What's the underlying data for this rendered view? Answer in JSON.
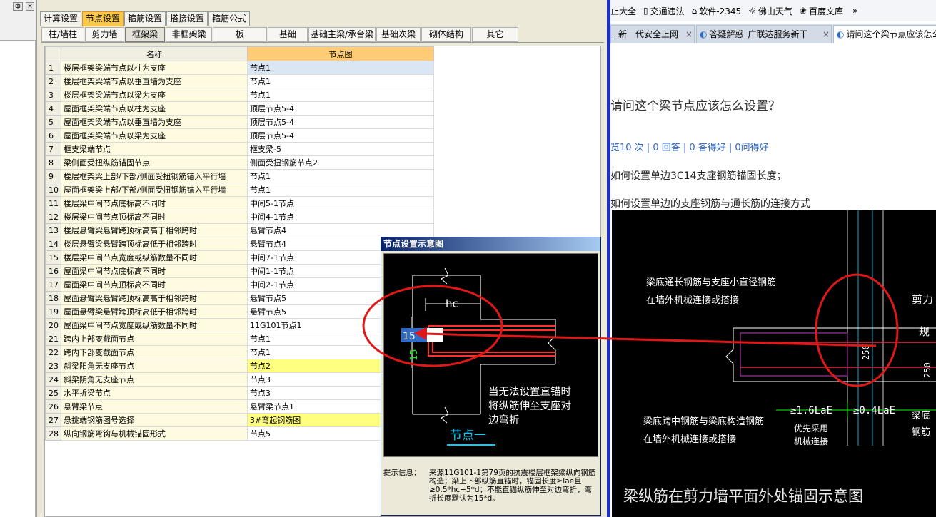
{
  "left_strip": {
    "pin": "ф",
    "close": "×"
  },
  "main_tabs": [
    "计算设置",
    "节点设置",
    "箍筋设置",
    "搭接设置",
    "箍筋公式"
  ],
  "main_tab_active": 1,
  "sub_tabs": [
    "柱/墙柱",
    "剪力墙",
    "框架梁",
    "非框架梁",
    "板",
    "基础",
    "基础主梁/承台梁",
    "基础次梁",
    "砌体结构",
    "其它"
  ],
  "sub_tab_active": 2,
  "grid": {
    "headers": [
      "",
      "名称",
      "节点图"
    ],
    "rows": [
      {
        "no": "1",
        "name": "楼层框架梁端节点以柱为支座",
        "value": "节点1"
      },
      {
        "no": "2",
        "name": "楼层框架梁端节点以垂直墙为支座",
        "value": "节点1"
      },
      {
        "no": "3",
        "name": "楼层框架梁端节点以梁为支座",
        "value": "节点1"
      },
      {
        "no": "4",
        "name": "屋面框架梁端节点以柱为支座",
        "value": "顶层节点5-4"
      },
      {
        "no": "5",
        "name": "屋面框架梁端节点以垂直墙为支座",
        "value": "顶层节点5-4"
      },
      {
        "no": "6",
        "name": "屋面框架梁端节点以梁为支座",
        "value": "顶层节点5-4"
      },
      {
        "no": "7",
        "name": "框支梁端节点",
        "value": "框支梁-5"
      },
      {
        "no": "8",
        "name": "梁侧面受扭纵筋锚固节点",
        "value": "侧面受扭钢筋节点2"
      },
      {
        "no": "9",
        "name": "楼层框架梁上部/下部/侧面受扭钢筋锚入平行墙",
        "value": "节点1"
      },
      {
        "no": "10",
        "name": "屋面框架梁上部/下部/侧面受扭钢筋锚入平行墙",
        "value": "节点1"
      },
      {
        "no": "11",
        "name": "楼层梁中间节点底标高不同时",
        "value": "中间5-1节点"
      },
      {
        "no": "12",
        "name": "楼层梁中间节点顶标高不同时",
        "value": "中间4-1节点"
      },
      {
        "no": "13",
        "name": "楼层悬臂梁悬臂跨顶标高高于相邻跨时",
        "value": "悬臂节点4"
      },
      {
        "no": "14",
        "name": "楼层悬臂梁悬臂跨顶标高低于相邻跨时",
        "value": "悬臂节点4"
      },
      {
        "no": "15",
        "name": "楼层梁中间节点宽度或纵筋数量不同时",
        "value": "中间7-1节点"
      },
      {
        "no": "16",
        "name": "屋面梁中间节点底标高不同时",
        "value": "中间1-1节点"
      },
      {
        "no": "17",
        "name": "屋面梁中间节点顶标高不同时",
        "value": "中间2-1节点"
      },
      {
        "no": "18",
        "name": "屋面悬臂梁悬臂跨顶标高高于相邻跨时",
        "value": "悬臂节点5"
      },
      {
        "no": "19",
        "name": "屋面悬臂梁悬臂跨顶标高低于相邻跨时",
        "value": "悬臂节点5"
      },
      {
        "no": "20",
        "name": "屋面梁中间节点宽度或纵筋数量不同时",
        "value": "11G101节点1"
      },
      {
        "no": "21",
        "name": "跨内上部变截面节点",
        "value": "节点1"
      },
      {
        "no": "22",
        "name": "跨内下部变截面节点",
        "value": "节点1"
      },
      {
        "no": "23",
        "name": "斜梁阳角无支座节点",
        "value": "节点2"
      },
      {
        "no": "24",
        "name": "斜梁阴角无支座节点",
        "value": "节点3"
      },
      {
        "no": "25",
        "name": "水平折梁节点",
        "value": "节点3"
      },
      {
        "no": "26",
        "name": "悬臂梁节点",
        "value": "悬臂梁节点1"
      },
      {
        "no": "27",
        "name": "悬挑端钢筋图号选择",
        "value": "3#弯起钢筋图"
      },
      {
        "no": "28",
        "name": "纵向钢筋弯钩与机械锚固形式",
        "value": "节点5"
      }
    ]
  },
  "popup": {
    "title": "节点设置示意图",
    "diagram": {
      "hc_label": "hc",
      "edit_value": "15",
      "vertical_label": "15",
      "note_lines": [
        "当无法设置直锚时",
        "将纵筋伸至支座对",
        "边弯折"
      ],
      "node_label": "节点一"
    },
    "hint_label": "提示信息：",
    "hint_text": "来源11G101-1第79页的抗震楼层框架梁纵向钢筋构造；梁上下部纵筋直锚时，锚固长度≥lae且≥0.5*hc+5*d；不能直锚纵筋伸至对边弯折，弯折长度默认为15*d。"
  },
  "browser": {
    "bookmarks": [
      {
        "icon": "",
        "label": "止大全"
      },
      {
        "icon": "page-icon",
        "label": "交通违法"
      },
      {
        "icon": "house-icon",
        "label": "软件-2345"
      },
      {
        "icon": "sun-icon",
        "label": "佛山天气"
      },
      {
        "icon": "paw-icon",
        "label": "百度文库"
      },
      {
        "icon": "more-icon",
        "label": "»"
      }
    ],
    "tabs": [
      {
        "label": "_新一代安全上网",
        "active": false
      },
      {
        "label": "答疑解惑_广联达服务新干",
        "active": false
      },
      {
        "label": "请问这个梁节点应该怎么",
        "active": true
      }
    ],
    "question_title": "请问这个梁节点应该怎么设置？",
    "stats": "览10 次 | 0 回答 | 0 答得好 | 0问得好",
    "lines": [
      "如何设置单边3C14支座钢筋锚固长度；",
      "如何设置单边的支座钢筋与通长筋的连接方式"
    ],
    "cad": {
      "label_top_1": "梁底通长钢筋与支座小直径钢筋",
      "label_top_2": "在墙外机械连接或搭接",
      "label_bot_1": "梁底跨中钢筋与梁底构造钢筋",
      "label_bot_2": "在墙外机械连接或搭接",
      "label_mid_1": "优先采用",
      "label_mid_2": "机械连接",
      "dim_1": "≥1.6LaE",
      "dim_2": "≥0.4LaE",
      "dim_v1": "250",
      "dim_v2": "250",
      "right_1": "剪力",
      "right_2": "梁底",
      "right_3": "钢筋",
      "right_4": "规",
      "caption": "梁纵筋在剪力墙平面外处锚固示意图"
    }
  },
  "colors": {
    "annotation_red": "#e01818",
    "cad_rebar": "#ff3030",
    "cad_cyan": "#00d0ff",
    "cad_green": "#00ff00",
    "tab_active": "#fbc94a",
    "header_highlight": "#ffcb74"
  }
}
